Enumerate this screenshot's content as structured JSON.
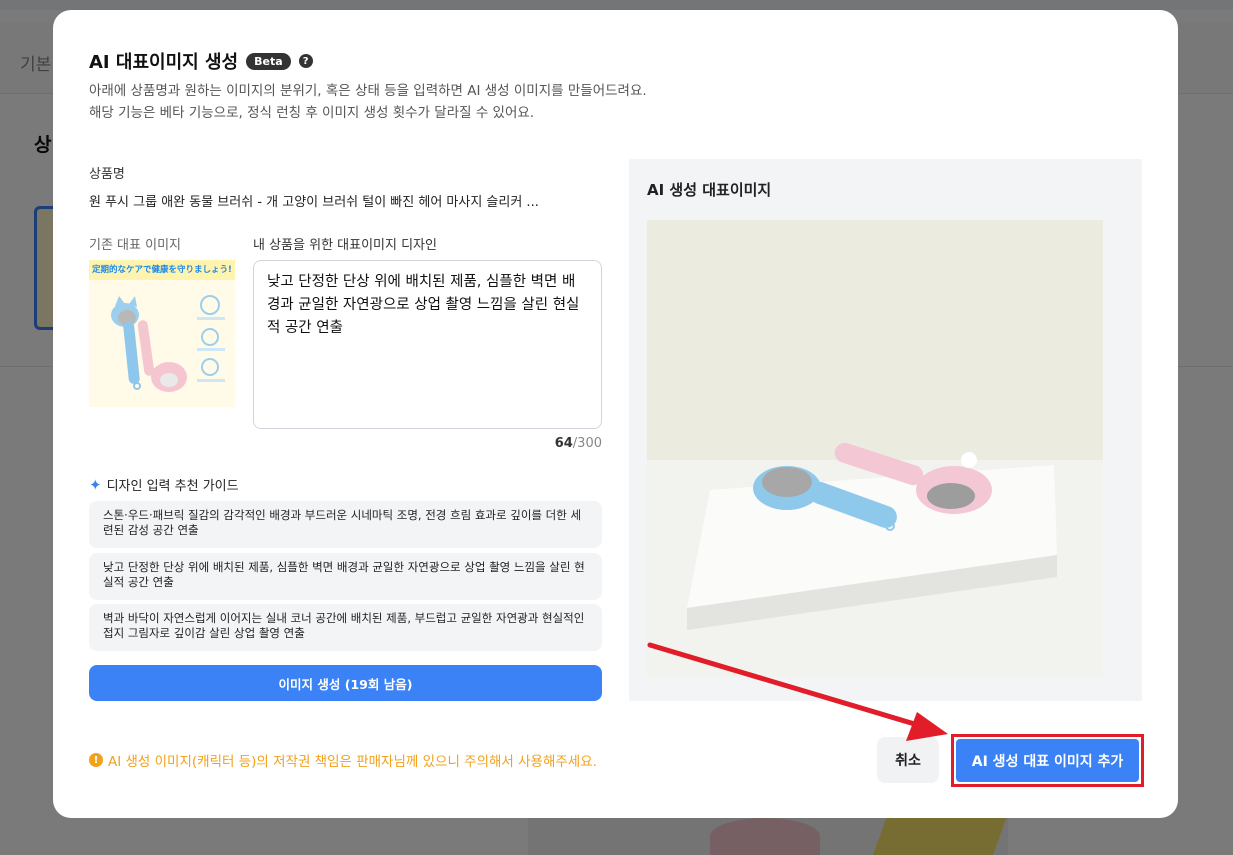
{
  "background": {
    "tab_text": "기본",
    "heading": "상"
  },
  "modal": {
    "title": "AI 대표이미지 생성",
    "beta_badge": "Beta",
    "help_icon": "?",
    "description_line1": "아래에 상품명과 원하는 이미지의 분위기, 혹은 상태 등을 입력하면 AI 생성 이미지를 만들어드려요.",
    "description_line2": "해당 기능은 베타 기능으로, 정식 런칭 후 이미지 생성 횟수가 달라질 수 있어요."
  },
  "product": {
    "label": "상품명",
    "name": "원 푸시 그룹 애완 동물 브러쉬 - 개 고양이 브러쉬 털이 빠진 헤어 마사지 슬리커 ..."
  },
  "original_image": {
    "label": "기존 대표 이미지",
    "banner_text": "定期的なケアで健康を守りましょう!"
  },
  "design_input": {
    "label": "내 상품을 위한 대표이미지 디자인",
    "value": "낮고 단정한 단상 위에 배치된 제품, 심플한 벽면 배경과 균일한 자연광으로 상업 촬영 느낌을 살린 현실적 공간 연출",
    "count": "64",
    "max": "/300"
  },
  "guide": {
    "title": "디자인 입력 추천 가이드",
    "items": [
      "스톤·우드·패브릭 질감의 감각적인 배경과 부드러운 시네마틱 조명, 전경 흐림 효과로 깊이를 더한 세련된 감성 공간 연출",
      "낮고 단정한 단상 위에 배치된 제품, 심플한 벽면 배경과 균일한 자연광으로 상업 촬영 느낌을 살린 현실적 공간 연출",
      "벽과 바닥이 자연스럽게 이어지는 실내 코너 공간에 배치된 제품, 부드럽고 균일한 자연광과 현실적인 접지 그림자로 깊이감 살린 상업 촬영 연출"
    ]
  },
  "generate_button": "이미지 생성 (19회 남음)",
  "ai_panel": {
    "title": "AI 생성 대표이미지"
  },
  "notice": "AI 생성 이미지(캐릭터 등)의 저작권 책임은 판매자님께 있으니 주의해서 사용해주세요.",
  "buttons": {
    "cancel": "취소",
    "add": "AI 생성 대표 이미지 추가"
  },
  "colors": {
    "accent": "#3b82f6",
    "warning": "#f2a11b",
    "highlight": "#e11d2a"
  }
}
